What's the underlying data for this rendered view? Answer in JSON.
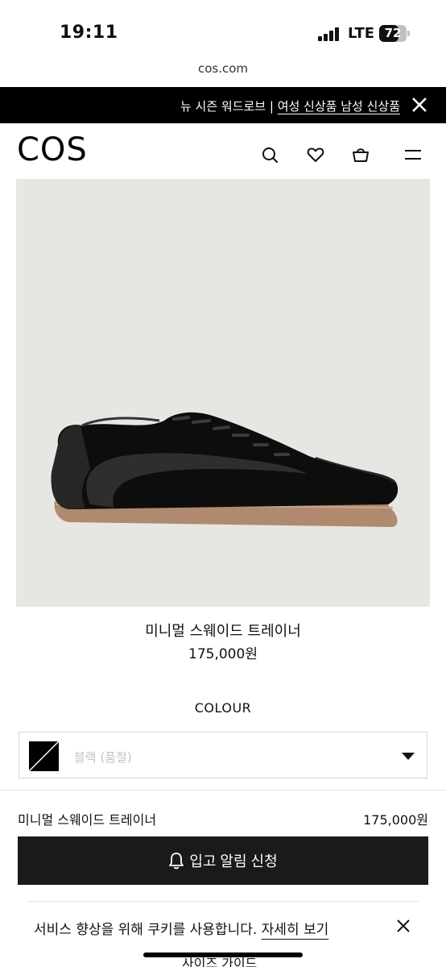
{
  "status_bar": {
    "time": "19:11",
    "network": "LTE",
    "battery": "72",
    "battery_level": 0.72
  },
  "browser": {
    "url": "cos.com"
  },
  "promo": {
    "text": "뉴 시즌 워드로브 | ",
    "link": "여성 신상품 남성 신상품"
  },
  "header": {
    "logo": "COS",
    "icons": [
      "search-icon",
      "heart-icon",
      "bag-icon",
      "menu-icon"
    ]
  },
  "product": {
    "title": "미니멀 스웨이드 트레이너",
    "price": "175,000원"
  },
  "colour": {
    "label": "COLOUR",
    "selected": "블랙 (품절)"
  },
  "sticky": {
    "name": "미니멀 스웨이드 트레이너",
    "price": "175,000원",
    "button_label": "입고 알림 신청"
  },
  "cookie": {
    "text": "서비스 향상을 위해 쿠키를 사용합니다. ",
    "link": "자세히 보기"
  },
  "footer": {
    "size_guide": "사이즈 가이드"
  },
  "colors": {
    "promo_bg": "#000000",
    "button_bg": "#1a1a1a",
    "image_bg": "#e6e6e3"
  }
}
